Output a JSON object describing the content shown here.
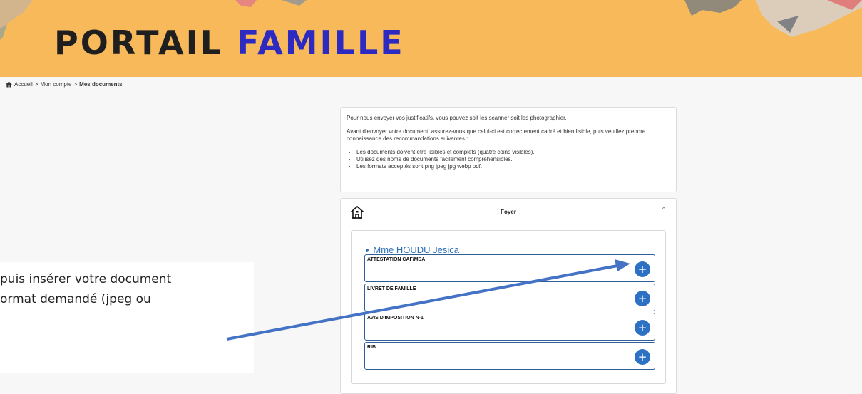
{
  "banner": {
    "title_part1": "PORTAIL",
    "title_part2": "FAMILLE",
    "background_color": "#f7b95a",
    "title_color_part1": "#1f1f1f",
    "title_color_part2": "#2d2ac2"
  },
  "breadcrumb": {
    "icon": "home-icon",
    "items": [
      "Accueil",
      "Mon compte",
      "Mes documents"
    ],
    "separator": ">"
  },
  "info": {
    "intro": "Pour nous envoyer vos justificatifs, vous pouvez soit les scanner soit les photographier.",
    "warning": "Avant d'envoyer votre document, assurez-vous que celui-ci est correctement cadré et bien lisible, puis veuillez prendre connaissance des recommandations suivantes :",
    "recommendations": [
      "Les documents doivent être lisibles et complets (quatre coins visibles).",
      "Utilisez des noms de documents facilement compréhensibles.",
      "Les formats acceptés sont png jpeg jpg webp pdf."
    ]
  },
  "foyer": {
    "icon": "house-icon",
    "title": "Foyer",
    "collapse_icon": "chevron-up-icon",
    "person": "Mme HOUDU Jesica",
    "documents": [
      {
        "label": "ATTESTATION CAF/MSA",
        "action": "+"
      },
      {
        "label": "LIVRET DE FAMILLE",
        "action": "+"
      },
      {
        "label": "AVIS D'IMPOSITION N-1",
        "action": "+"
      },
      {
        "label": "RIB",
        "action": "+"
      }
    ],
    "button_color": "#2c71c4"
  },
  "overlay": {
    "lines": [
      "puis insérer votre document",
      "ormat demandé (jpeg ou"
    ],
    "arrow_color": "#4472c4"
  }
}
